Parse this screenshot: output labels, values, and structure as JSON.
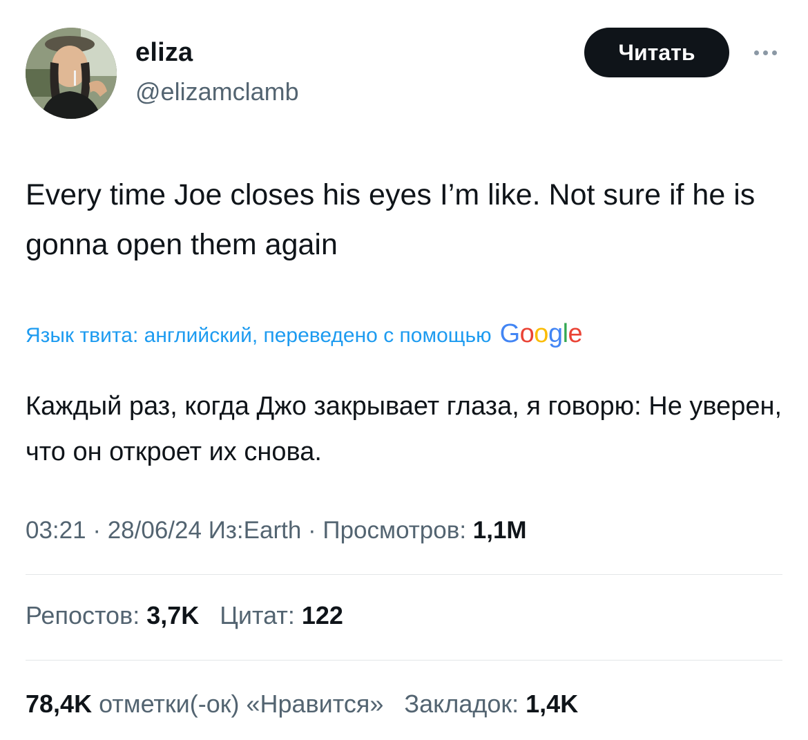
{
  "user": {
    "name": "eliza",
    "handle": "@elizamclamb"
  },
  "header": {
    "follow_label": "Читать"
  },
  "tweet": {
    "text": "Every time Joe closes his eyes I’m like. Not sure if he is gonna open them again",
    "translate_note": "Язык твита: английский, переведено с помощью",
    "translate_brand": "Google",
    "translated_text": "Каждый раз, когда Джо закрывает глаза, я говорю: Не уверен, что он откроет их снова."
  },
  "meta": {
    "time": "03:21",
    "date": "28/06/24",
    "source": "Из:Earth",
    "views_label": "Просмотров:",
    "views_value": "1,1M"
  },
  "stats": {
    "reposts_label": "Репостов:",
    "reposts_value": "3,7K",
    "quotes_label": "Цитат:",
    "quotes_value": "122",
    "likes_value": "78,4K",
    "likes_label": "отметки(-ок) «Нравится»",
    "bookmarks_label": "Закладок:",
    "bookmarks_value": "1,4K"
  },
  "icons": {
    "avatar": "profile-photo",
    "more": "more-dots-icon"
  },
  "colors": {
    "link_blue": "#1d9bf0",
    "secondary_text": "#536471",
    "primary_text": "#0f1419",
    "button_bg": "#0f1419"
  }
}
